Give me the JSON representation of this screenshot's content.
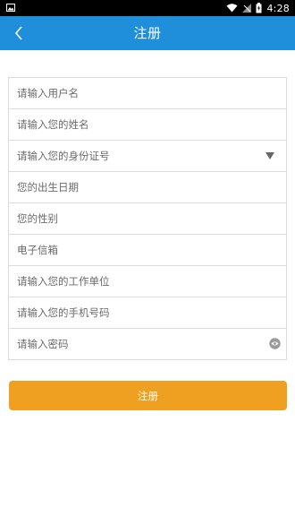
{
  "status_bar": {
    "time": "4:28",
    "icons": [
      "image-icon",
      "wifi-icon",
      "signal-icon",
      "battery-icon"
    ]
  },
  "app_bar": {
    "title": "注册",
    "back_icon": "chevron-left-icon"
  },
  "form": {
    "fields": [
      {
        "name": "username-input",
        "placeholder": "请输入用户名"
      },
      {
        "name": "name-input",
        "placeholder": "请输入您的姓名"
      },
      {
        "name": "id-type-select",
        "placeholder": "请输入您的身份证号",
        "icon": "dropdown-arrow-icon"
      },
      {
        "name": "birthdate-input",
        "placeholder": "您的出生日期"
      },
      {
        "name": "gender-input",
        "placeholder": "您的性别"
      },
      {
        "name": "email-input",
        "placeholder": "电子信箱"
      },
      {
        "name": "workplace-input",
        "placeholder": "请输入您的工作单位"
      },
      {
        "name": "phone-input",
        "placeholder": "请输入您的手机号码"
      },
      {
        "name": "password-input",
        "placeholder": "请输入密码",
        "icon": "eye-icon"
      }
    ]
  },
  "submit": {
    "label": "注册"
  },
  "colors": {
    "app_bar": "#1f8fdc",
    "button": "#f0a020",
    "border": "#dcdcdc"
  }
}
